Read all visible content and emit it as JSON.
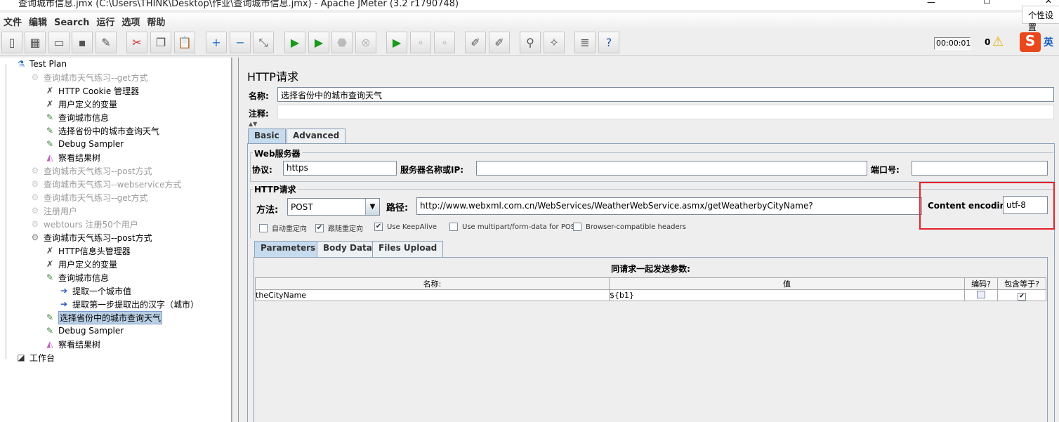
{
  "window": {
    "title": "查询城市信息.jmx (C:\\Users\\THINK\\Desktop\\作业\\查询城市信息.jmx) - Apache JMeter (3.2 r1790748)",
    "tooltip": "个性设置"
  },
  "menu": [
    "文件",
    "编辑",
    "Search",
    "运行",
    "选项",
    "帮助"
  ],
  "toolbar": {
    "icons": [
      "new-icon",
      "templates-icon",
      "open-icon",
      "save-icon",
      "save-as-icon",
      "cut-icon",
      "copy-icon",
      "paste-icon",
      "expand-icon",
      "collapse-icon",
      "toggle-icon",
      "start-icon",
      "start-no-pause-icon",
      "stop-icon",
      "shutdown-icon",
      "remote-start-icon",
      "remote-stop-icon",
      "remote-shutdown-icon",
      "clear-icon",
      "clear-all-icon",
      "search-icon",
      "reset-search-icon",
      "function-helper-icon",
      "help-icon"
    ],
    "timer": "00:00:01",
    "warnings": "0",
    "ime": "英"
  },
  "tree": [
    {
      "label": "Test Plan",
      "level": 0,
      "icon": "test-plan-icon"
    },
    {
      "label": "查询城市天气练习--get方式",
      "level": 1,
      "icon": "thread-group-icon",
      "disabled": true
    },
    {
      "label": "HTTP Cookie 管理器",
      "level": 2,
      "icon": "config-icon"
    },
    {
      "label": "用户定义的变量",
      "level": 2,
      "icon": "config-icon"
    },
    {
      "label": "查询城市信息",
      "level": 2,
      "icon": "sampler-icon"
    },
    {
      "label": "选择省份中的城市查询天气",
      "level": 2,
      "icon": "sampler-icon"
    },
    {
      "label": "Debug Sampler",
      "level": 2,
      "icon": "sampler-icon"
    },
    {
      "label": "察看结果树",
      "level": 2,
      "icon": "listener-icon"
    },
    {
      "label": "查询城市天气练习--post方式",
      "level": 1,
      "icon": "thread-group-icon",
      "disabled": true
    },
    {
      "label": "查询城市天气练习--webservice方式",
      "level": 1,
      "icon": "thread-group-icon",
      "disabled": true
    },
    {
      "label": "查询城市天气练习--get方式",
      "level": 1,
      "icon": "thread-group-icon",
      "disabled": true
    },
    {
      "label": "注册用户",
      "level": 1,
      "icon": "thread-group-icon",
      "disabled": true
    },
    {
      "label": "webtours 注册50个用户",
      "level": 1,
      "icon": "thread-group-icon",
      "disabled": true
    },
    {
      "label": "查询城市天气练习--post方式",
      "level": 1,
      "icon": "thread-group-icon"
    },
    {
      "label": "HTTP信息头管理器",
      "level": 2,
      "icon": "config-icon"
    },
    {
      "label": "用户定义的变量",
      "level": 2,
      "icon": "config-icon"
    },
    {
      "label": "查询城市信息",
      "level": 2,
      "icon": "sampler-icon"
    },
    {
      "label": "提取一个城市值",
      "level": 3,
      "icon": "extractor-icon"
    },
    {
      "label": "提取第一步提取出的汉字（城市）",
      "level": 3,
      "icon": "extractor-icon"
    },
    {
      "label": "选择省份中的城市查询天气",
      "level": 2,
      "icon": "sampler-icon",
      "selected": true
    },
    {
      "label": "Debug Sampler",
      "level": 2,
      "icon": "sampler-icon"
    },
    {
      "label": "察看结果树",
      "level": 2,
      "icon": "listener-icon"
    },
    {
      "label": "工作台",
      "level": 0,
      "icon": "workbench-icon"
    }
  ],
  "panel": {
    "title": "HTTP请求",
    "name_label": "名称:",
    "name_value": "选择省份中的城市查询天气",
    "comment_label": "注释:",
    "comment_value": "",
    "tabs": [
      "Basic",
      "Advanced"
    ],
    "web_server": {
      "legend": "Web服务器",
      "protocol_label": "协议:",
      "protocol": "https",
      "server_label": "服务器名称或IP:",
      "server": "",
      "port_label": "端口号:",
      "port": ""
    },
    "http_request": {
      "legend": "HTTP请求",
      "method_label": "方法:",
      "method": "POST",
      "path_label": "路径:",
      "path": "http://www.webxml.com.cn/WebServices/WeatherWebService.asmx/getWeatherbyCityName?",
      "encoding_label": "Content encoding:",
      "encoding": "utf-8"
    },
    "checkboxes": [
      {
        "label": "自动重定向",
        "checked": false
      },
      {
        "label": "跟随重定向",
        "checked": true
      },
      {
        "label": "Use KeepAlive",
        "checked": true
      },
      {
        "label": "Use multipart/form-data for POST",
        "checked": false
      },
      {
        "label": "Browser-compatible headers",
        "checked": false
      }
    ],
    "sub_tabs": [
      "Parameters",
      "Body Data",
      "Files Upload"
    ],
    "params_title": "同请求一起发送参数:",
    "columns": [
      "名称:",
      "值",
      "编码?",
      "包含等于?"
    ],
    "rows": [
      {
        "name": "theCityName",
        "value": "${b1}",
        "encode": false,
        "include_equals": true
      }
    ]
  },
  "highlight_color": "#e8202a"
}
